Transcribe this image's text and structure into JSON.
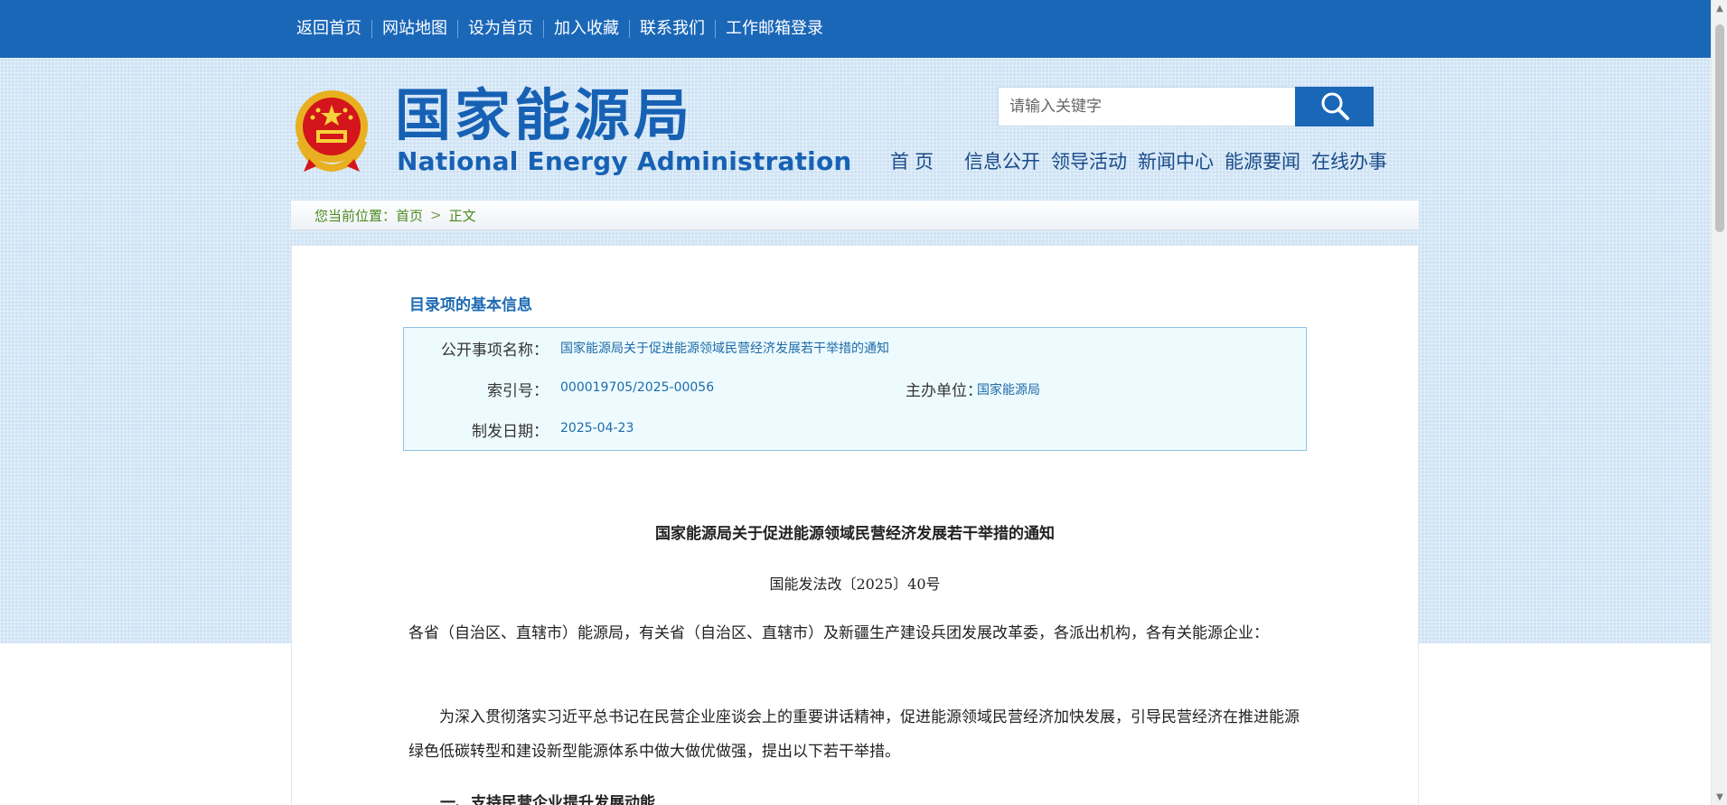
{
  "topnav": {
    "items": [
      "返回首页",
      "网站地图",
      "设为首页",
      "加入收藏",
      "联系我们",
      "工作邮箱登录"
    ]
  },
  "header": {
    "logo_cn": "国家能源局",
    "logo_en": "National Energy Administration",
    "emblem_icon": "national-emblem-icon"
  },
  "search": {
    "placeholder": "请输入关键字",
    "button_icon": "search-icon"
  },
  "mainnav": {
    "items": [
      "首页",
      "信息公开",
      "领导活动",
      "新闻中心",
      "能源要闻",
      "在线办事"
    ]
  },
  "breadcrumb": {
    "prefix": "您当前位置：",
    "home": "首页",
    "separator": ">",
    "current": "正文"
  },
  "info": {
    "title": "目录项的基本信息",
    "name_label": "公开事项名称：",
    "name_value": "国家能源局关于促进能源领域民营经济发展若干举措的通知",
    "index_label": "索引号：",
    "index_value": "000019705/2025-00056",
    "issuer_label": "主办单位：",
    "issuer_value": "国家能源局",
    "date_label": "制发日期：",
    "date_value": "2025-04-23"
  },
  "document": {
    "title": "国家能源局关于促进能源领域民营经济发展若干举措的通知",
    "number": "国能发法改〔2025〕40号",
    "recipients": "各省（自治区、直辖市）能源局，有关省（自治区、直辖市）及新疆生产建设兵团发展改革委，各派出机构，各有关能源企业：",
    "intro": "为深入贯彻落实习近平总书记在民营企业座谈会上的重要讲话精神，促进能源领域民营经济加快发展，引导民营经济在推进能源绿色低碳转型和建设新型能源体系中做大做优做强，提出以下若干举措。",
    "section1": "一、支持民营企业提升发展动能"
  },
  "colors": {
    "brand_blue": "#1a67b8",
    "logo_blue": "#1761b4",
    "breadcrumb_green": "#4d8a1f",
    "info_bg": "#eefbfe"
  }
}
